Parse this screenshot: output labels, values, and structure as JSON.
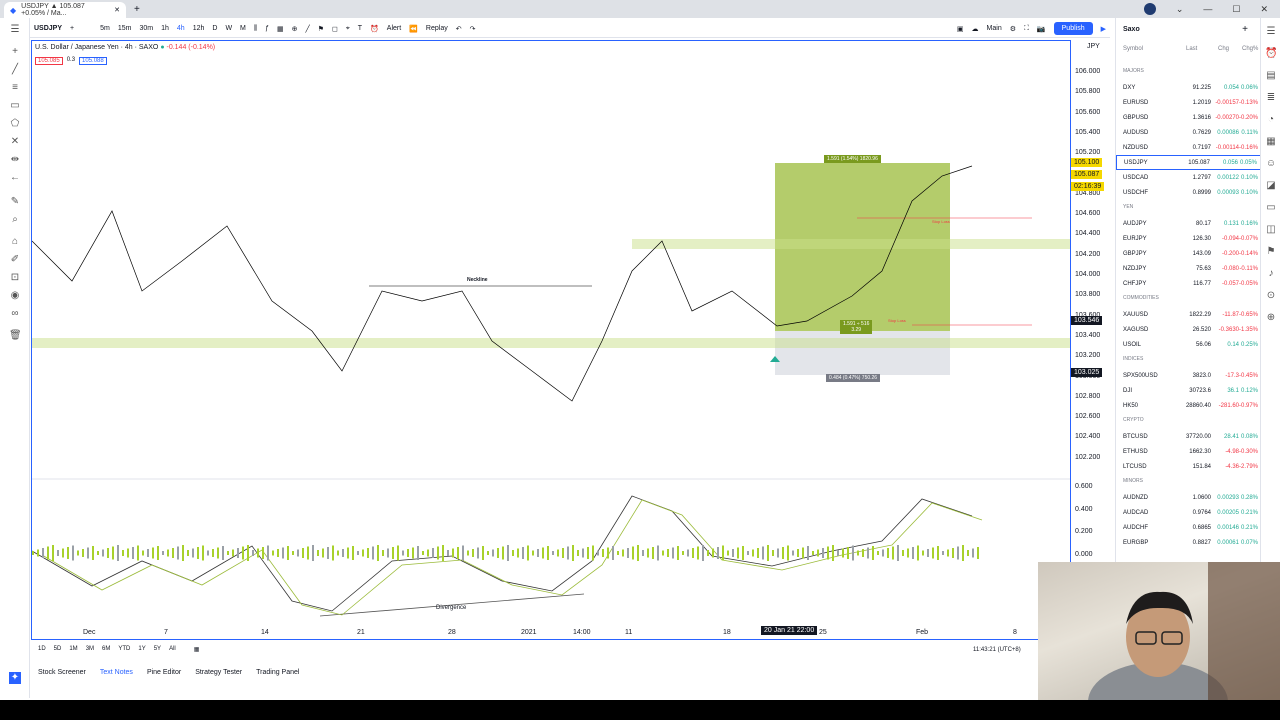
{
  "browser": {
    "tab_title": "USDJPY ▲ 105.087 +0.05% / Ma...",
    "new_tab": "+"
  },
  "toolbar": {
    "symbol": "USDJPY",
    "intervals": [
      "5m",
      "15m",
      "30m",
      "1h",
      "4h",
      "12h",
      "D",
      "W",
      "M"
    ],
    "alert": "Alert",
    "replay": "Replay",
    "layout": "Main",
    "publish": "Publish"
  },
  "chart": {
    "title": "U.S. Dollar / Japanese Yen · 4h · SAXO",
    "change": "-0.144 (-0.14%)",
    "bid": "105.085",
    "spread": "0.3",
    "ask": "105.088",
    "currency": "JPY",
    "neckline": "Neckline",
    "divergence": "Divergence",
    "target_label": "1.591 (1.54%) 1820.96",
    "stop_label": "0.484 (0.47%) 750.26",
    "rr_label": "1.591 ÷ 516\n3.29",
    "stop_loss": "Stop Loss",
    "price_levels": [
      "106.000",
      "105.800",
      "105.600",
      "105.400",
      "105.200",
      "105.000",
      "104.800",
      "104.600",
      "104.400",
      "104.200",
      "104.000",
      "103.800",
      "103.600",
      "103.400",
      "103.200",
      "103.000",
      "102.800",
      "102.600",
      "102.400",
      "102.200"
    ],
    "price_tag_current": "105.087",
    "price_tag_a": "105.100",
    "price_tag_time": "02:16:39",
    "price_tag_b": "103.546",
    "price_tag_c": "103.025",
    "osc_levels": [
      "0.600",
      "0.400",
      "0.200",
      "0.000"
    ],
    "x_labels": [
      "Dec",
      "7",
      "14",
      "21",
      "28",
      "2021",
      "14:00",
      "11",
      "18",
      "20 Jan 21",
      "22:00",
      "25",
      "Feb",
      "8"
    ]
  },
  "ranges": [
    "1D",
    "5D",
    "1M",
    "3M",
    "6M",
    "YTD",
    "1Y",
    "5Y",
    "All"
  ],
  "clock": "11:43:21 (UTC+8)",
  "bottom_tabs": [
    "Stock Screener",
    "Text Notes",
    "Pine Editor",
    "Strategy Tester",
    "Trading Panel"
  ],
  "watchlist": {
    "name": "Saxo",
    "headers": [
      "Symbol",
      "Last",
      "Chg",
      "Chg%"
    ],
    "rows": [
      {
        "section": "MAJORS"
      },
      {
        "s": "DXY",
        "l": "91.225",
        "c": "0.054",
        "p": "0.06%",
        "d": "up"
      },
      {
        "s": "EURUSD",
        "l": "1.2019",
        "c": "-0.00157",
        "p": "-0.13%",
        "d": "dn"
      },
      {
        "s": "GBPUSD",
        "l": "1.3616",
        "c": "-0.00270",
        "p": "-0.20%",
        "d": "dn"
      },
      {
        "s": "AUDUSD",
        "l": "0.7629",
        "c": "0.00086",
        "p": "0.11%",
        "d": "up"
      },
      {
        "s": "NZDUSD",
        "l": "0.7197",
        "c": "-0.00114",
        "p": "-0.16%",
        "d": "dn"
      },
      {
        "s": "USDJPY",
        "l": "105.087",
        "c": "0.056",
        "p": "0.05%",
        "d": "up"
      },
      {
        "s": "USDCAD",
        "l": "1.2797",
        "c": "0.00122",
        "p": "0.10%",
        "d": "up"
      },
      {
        "s": "USDCHF",
        "l": "0.8999",
        "c": "0.00093",
        "p": "0.10%",
        "d": "up"
      },
      {
        "section": "YEN"
      },
      {
        "s": "AUDJPY",
        "l": "80.17",
        "c": "0.131",
        "p": "0.16%",
        "d": "up"
      },
      {
        "s": "EURJPY",
        "l": "126.30",
        "c": "-0.094",
        "p": "-0.07%",
        "d": "dn"
      },
      {
        "s": "GBPJPY",
        "l": "143.09",
        "c": "-0.200",
        "p": "-0.14%",
        "d": "dn"
      },
      {
        "s": "NZDJPY",
        "l": "75.63",
        "c": "-0.080",
        "p": "-0.11%",
        "d": "dn"
      },
      {
        "s": "CHFJPY",
        "l": "116.77",
        "c": "-0.057",
        "p": "-0.05%",
        "d": "dn"
      },
      {
        "section": "COMMODITIES"
      },
      {
        "s": "XAUUSD",
        "l": "1822.29",
        "c": "-11.87",
        "p": "-0.65%",
        "d": "dn"
      },
      {
        "s": "XAGUSD",
        "l": "26.520",
        "c": "-0.3630",
        "p": "-1.35%",
        "d": "dn"
      },
      {
        "s": "USOIL",
        "l": "56.06",
        "c": "0.14",
        "p": "0.25%",
        "d": "up"
      },
      {
        "section": "INDICES"
      },
      {
        "s": "SPX500USD",
        "l": "3823.0",
        "c": "-17.3",
        "p": "-0.45%",
        "d": "dn"
      },
      {
        "s": "DJI",
        "l": "30723.6",
        "c": "36.1",
        "p": "0.12%",
        "d": "up"
      },
      {
        "s": "HK50",
        "l": "28860.40",
        "c": "-281.60",
        "p": "-0.97%",
        "d": "dn"
      },
      {
        "section": "CRYPTO"
      },
      {
        "s": "BTCUSD",
        "l": "37720.00",
        "c": "28.41",
        "p": "0.08%",
        "d": "up"
      },
      {
        "s": "ETHUSD",
        "l": "1662.30",
        "c": "-4.98",
        "p": "-0.30%",
        "d": "dn"
      },
      {
        "s": "LTCUSD",
        "l": "151.84",
        "c": "-4.36",
        "p": "-2.79%",
        "d": "dn"
      },
      {
        "section": "MINORS"
      },
      {
        "s": "AUDNZD",
        "l": "1.0600",
        "c": "0.00293",
        "p": "0.28%",
        "d": "up"
      },
      {
        "s": "AUDCAD",
        "l": "0.9764",
        "c": "0.00205",
        "p": "0.21%",
        "d": "up"
      },
      {
        "s": "AUDCHF",
        "l": "0.6865",
        "c": "0.00146",
        "p": "0.21%",
        "d": "up"
      },
      {
        "s": "EURGBP",
        "l": "0.8827",
        "c": "0.00061",
        "p": "0.07%",
        "d": "up"
      }
    ]
  },
  "colors": {
    "accent": "#2962ff",
    "up": "#22ab94",
    "down": "#f23645",
    "candle_up": "#a8d12b",
    "zone": "#9bbb3a"
  }
}
